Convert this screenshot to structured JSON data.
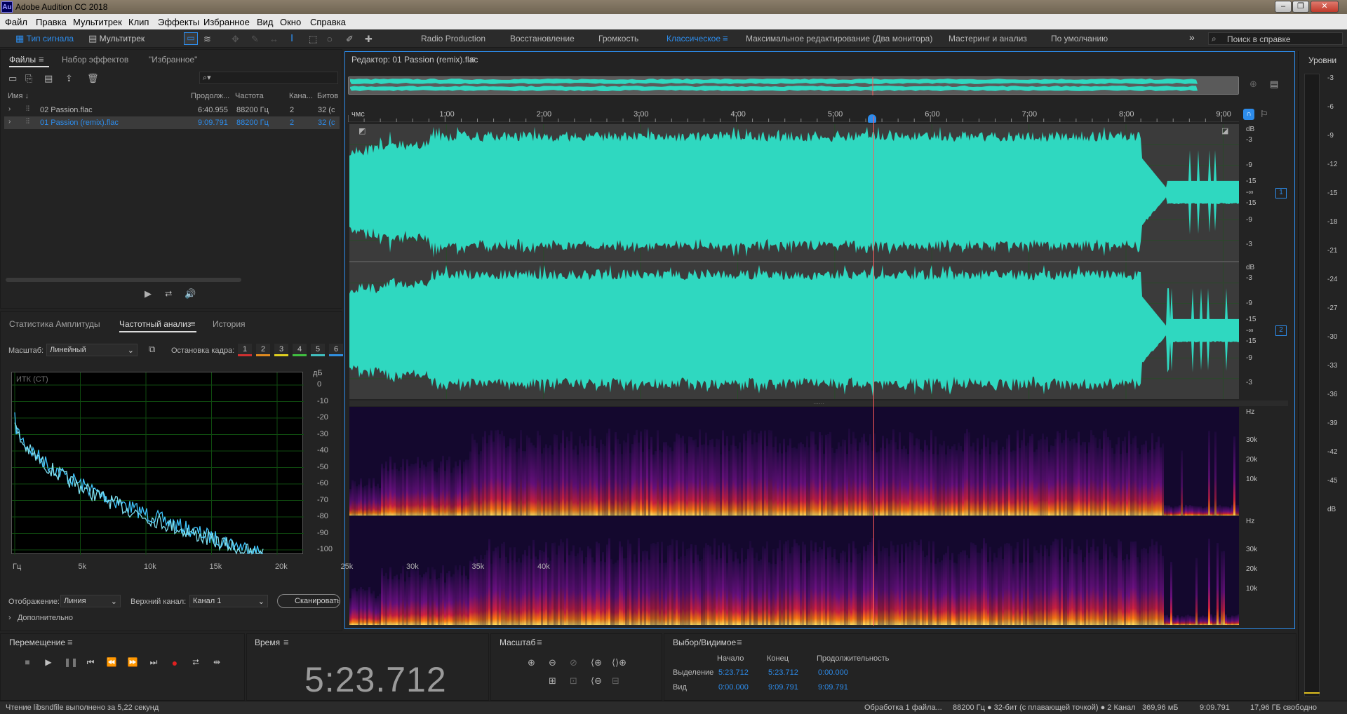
{
  "app": {
    "title": "Adobe Audition CC 2018",
    "icon_text": "Au",
    "accent": "#2d8ceb",
    "waveform_color": "#2fd8c0"
  },
  "menu": [
    "Файл",
    "Правка",
    "Мультитрек",
    "Клип",
    "Эффекты",
    "Избранное",
    "Вид",
    "Окно",
    "Справка"
  ],
  "toolbar": {
    "view_waveform": "Тип сигнала",
    "view_multitrack": "Мультитрек",
    "workspaces": [
      "Radio Production",
      "Восстановление",
      "Громкость",
      "Классическое",
      "Максимальное редактирование (Два монитора)",
      "Мастеринг и анализ",
      "По умолчанию"
    ],
    "active_workspace": "Классическое",
    "more": "»",
    "search_placeholder": "Поиск в справке"
  },
  "files_panel": {
    "tabs": [
      "Файлы",
      "Набор эффектов",
      "\"Избранное\""
    ],
    "search_icon": "⌕▾",
    "columns": [
      "Имя",
      "Продолж...",
      "Частота",
      "Кана...",
      "Битов"
    ],
    "rows": [
      {
        "name": "02 Passion.flac",
        "duration": "6:40.955",
        "rate": "88200 Гц",
        "channels": "2",
        "bits": "32 (c"
      },
      {
        "name": "01 Passion (remix).flac",
        "duration": "9:09.791",
        "rate": "88200 Гц",
        "channels": "2",
        "bits": "32 (c"
      }
    ]
  },
  "analysis_panel": {
    "tabs": [
      "Статистика Амплитуды",
      "Частотный анализ",
      "История"
    ],
    "scale_label": "Масштаб:",
    "scale_value": "Линейный",
    "freeze_label": "Остановка кадра:",
    "freeze_slots": [
      "1",
      "2",
      "3",
      "4",
      "5",
      "6"
    ],
    "freeze_colors": [
      "#d03030",
      "#e08a20",
      "#e0d020",
      "#40c040",
      "#40c0c0",
      "#3090e0"
    ],
    "graph_label": "ИТК (СТ)",
    "y_unit": "дБ",
    "y_ticks": [
      "0",
      "-10",
      "-20",
      "-30",
      "-40",
      "-50",
      "-60",
      "-70",
      "-80",
      "-90",
      "-100"
    ],
    "x_ticks": [
      "Гц",
      "5k",
      "10k",
      "15k",
      "20k",
      "25k",
      "30k",
      "35k",
      "40k"
    ],
    "display_label": "Отображение:",
    "display_value": "Линия",
    "channel_label": "Верхний канал:",
    "channel_value": "Канал 1",
    "scan_button": "Сканировать",
    "advanced": "Дополнительно"
  },
  "editor": {
    "title": "Редактор: 01 Passion (remix).flac",
    "ruler_unit": "чмс",
    "ruler_ticks": [
      "1:00",
      "2:00",
      "3:00",
      "4:00",
      "5:00",
      "6:00",
      "7:00",
      "8:00",
      "9:00"
    ],
    "db_label": "dB",
    "db_ticks": [
      "-3",
      "-9",
      "-15",
      "-∞",
      "-15",
      "-9",
      "-3"
    ],
    "channel_badges": [
      "1",
      "2"
    ],
    "hz_label": "Hz",
    "hz_ticks": [
      "30k",
      "20k",
      "10k"
    ],
    "duration_seconds": 549.791,
    "playhead_seconds": 323.712
  },
  "levels": {
    "title": "Уровни",
    "ticks": [
      "-3",
      "-6",
      "-9",
      "-12",
      "-15",
      "-18",
      "-21",
      "-24",
      "-27",
      "-30",
      "-33",
      "-36",
      "-39",
      "-42",
      "-45",
      "dB"
    ]
  },
  "transport": {
    "title": "Перемещение",
    "buttons": [
      "stop",
      "play",
      "pause",
      "to-start",
      "rewind",
      "fast-forward",
      "to-end",
      "record",
      "loop",
      "skip"
    ]
  },
  "time_panel": {
    "title": "Время",
    "value": "5:23.712"
  },
  "zoom_panel": {
    "title": "Масштаб"
  },
  "selection_panel": {
    "title": "Выбор/Видимое",
    "headers": [
      "Начало",
      "Конец",
      "Продолжительность"
    ],
    "rows": [
      {
        "label": "Выделение",
        "start": "5:23.712",
        "end": "5:23.712",
        "duration": "0:00.000"
      },
      {
        "label": "Вид",
        "start": "0:00.000",
        "end": "9:09.791",
        "duration": "9:09.791"
      }
    ]
  },
  "status": {
    "left": "Чтение libsndfile выполнено за 5,22 секунд",
    "processing": "Обработка 1 файла...",
    "format": "88200 Гц ● 32-бит (с плавающей точкой) ● 2 Канал",
    "size": "369,96 мБ",
    "duration": "9:09.791",
    "free": "17,96 ГБ свободно"
  }
}
